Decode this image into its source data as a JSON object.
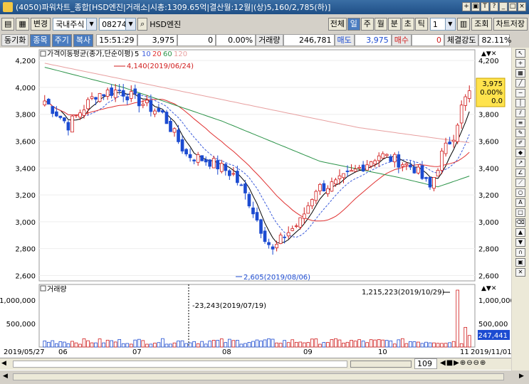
{
  "window": {
    "title": "(4050)파워차트_종합[HSD엔진|거래소|시총:1309.65억|결산월:12월|(상)5,160/2,785(하)]",
    "buttons": [
      "+",
      "T",
      "?",
      "_",
      "□",
      "×"
    ]
  },
  "toolbar": {
    "change_label": "변경",
    "market_select": "국내주식",
    "code": "082740",
    "stock_name": "HSD엔진",
    "period_buttons": [
      "전체",
      "일",
      "주",
      "월",
      "분",
      "초",
      "틱"
    ],
    "active_period": "일",
    "count_value": "1",
    "lookup_label": "조회",
    "save_label": "차트저장"
  },
  "inforow": {
    "sync_label": "동기화",
    "tabs": [
      "종목",
      "주기",
      "복사"
    ],
    "time": "15:51:29",
    "price": "3,975",
    "change": "0",
    "change_pct": "0.00%",
    "volume_label": "거래량",
    "volume": "246,781",
    "sell_label": "매도",
    "sell_value": "3,975",
    "buy_label": "매수",
    "buy_value": "0",
    "strength_label": "체결강도",
    "strength_value": "82.11%"
  },
  "price_panel": {
    "legend_title": "가격이동평균(종가,단순이평)",
    "ma_periods": [
      "5",
      "10",
      "20",
      "60",
      "120"
    ],
    "ma_colors": [
      "#000000",
      "#3b5bdb",
      "#e03131",
      "#2b9348",
      "#e8a0a0"
    ],
    "y_ticks": [
      "4,200",
      "4,000",
      "3,800",
      "3,600",
      "3,400",
      "3,200",
      "3,000",
      "2,800",
      "2,600"
    ],
    "high_annotation": "4,140(2019/06/24)",
    "low_annotation": "2,605(2019/08/06)",
    "current_badge": {
      "price": "3,975",
      "pct": "0.00%",
      "chg": "0.0"
    }
  },
  "volume_panel": {
    "legend_title": "거래량",
    "y_ticks": [
      "1,000,000",
      "500,000"
    ],
    "y_ticks_right": [
      "1,000,000",
      "500,000"
    ],
    "max_annotation": "1,215,223(2019/10/29)",
    "crosshair_annotation": "-23,243(2019/07/19)",
    "current_badge": "247,441"
  },
  "x_axis": {
    "start_label": "2019/05/27",
    "months": [
      "06",
      "07",
      "08",
      "09",
      "10",
      "11"
    ],
    "end_label": "2019/11/01"
  },
  "bottom": {
    "zoom_value": "109"
  },
  "chart_data": {
    "type": "candlestick",
    "price_range": [
      2560,
      4280
    ],
    "start_price": 3900,
    "low_price": 2605,
    "high_price": 4140,
    "end_price": 3975,
    "volume_max": 1215223,
    "volume_current": 247441
  }
}
